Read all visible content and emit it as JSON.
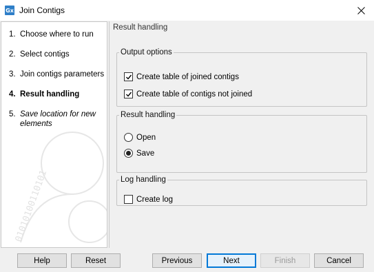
{
  "window": {
    "icon_text": "Gx",
    "title": "Join Contigs"
  },
  "steps": [
    {
      "num": "1.",
      "label": "Choose where to run"
    },
    {
      "num": "2.",
      "label": "Select contigs"
    },
    {
      "num": "3.",
      "label": "Join contigs parameters"
    },
    {
      "num": "4.",
      "label": "Result handling"
    },
    {
      "num": "5.",
      "label": "Save location for new elements"
    }
  ],
  "main": {
    "pane_title": "Result handling",
    "output_options": {
      "legend": "Output options",
      "joined_label": "Create table of joined contigs",
      "joined_checked": true,
      "not_joined_label": "Create table of contigs not joined",
      "not_joined_checked": true
    },
    "result_handling": {
      "legend": "Result handling",
      "open_label": "Open",
      "save_label": "Save",
      "selected": "Save"
    },
    "log_handling": {
      "legend": "Log handling",
      "create_log_label": "Create log",
      "create_log_checked": false
    }
  },
  "buttons": {
    "help": "Help",
    "reset": "Reset",
    "previous": "Previous",
    "next": "Next",
    "finish": "Finish",
    "cancel": "Cancel"
  },
  "watermark_text": "01010100110101"
}
